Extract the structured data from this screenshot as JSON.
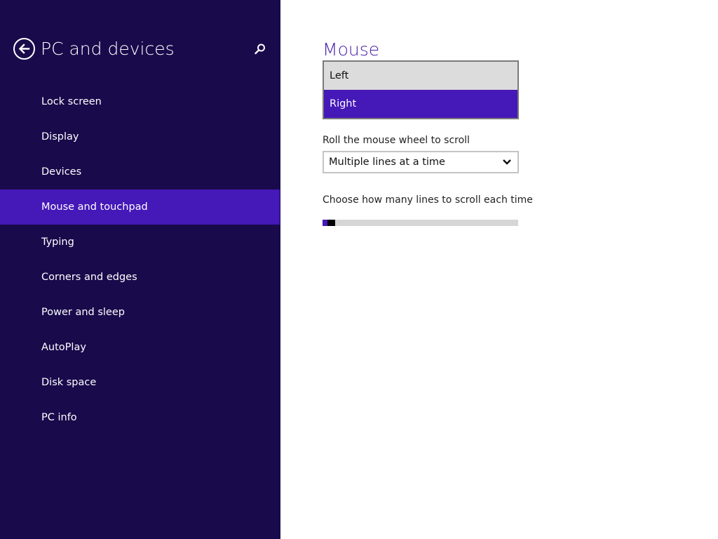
{
  "sidebar": {
    "title": "PC and devices",
    "back_icon": "back-arrow-icon",
    "search_icon": "search-icon",
    "items": [
      {
        "label": "Lock screen"
      },
      {
        "label": "Display"
      },
      {
        "label": "Devices"
      },
      {
        "label": "Mouse and touchpad",
        "selected": true
      },
      {
        "label": "Typing"
      },
      {
        "label": "Corners and edges"
      },
      {
        "label": "Power and sleep"
      },
      {
        "label": "AutoPlay"
      },
      {
        "label": "Disk space"
      },
      {
        "label": "PC info"
      }
    ]
  },
  "main": {
    "title": "Mouse",
    "primary_button": {
      "options": [
        "Left",
        "Right"
      ],
      "selected": "Right"
    },
    "scroll": {
      "label": "Roll the mouse wheel to scroll",
      "value": "Multiple lines at a time",
      "chevron_icon": "chevron-down-icon"
    },
    "lines": {
      "label": "Choose how many lines to scroll each time",
      "value": 3,
      "min": 1,
      "max": 100
    }
  },
  "colors": {
    "sidebar_bg": "#180a4b",
    "accent": "#4518b8",
    "title_accent": "#4a22a8"
  }
}
